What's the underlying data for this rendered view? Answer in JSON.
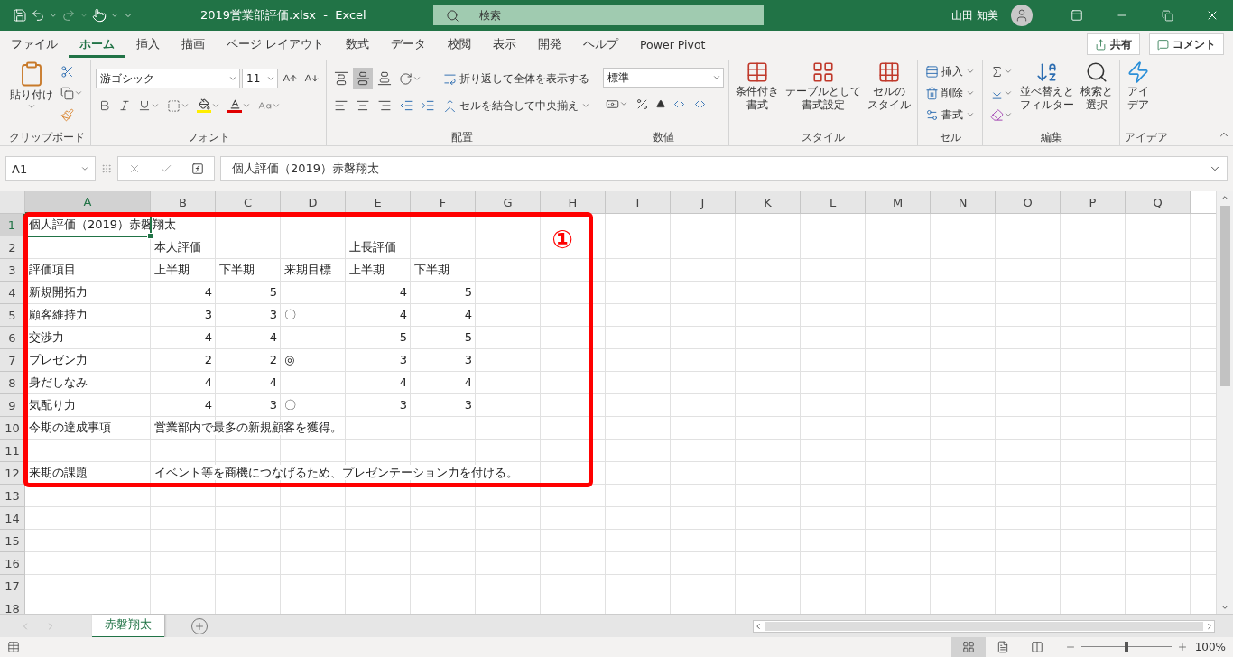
{
  "title_bar": {
    "title": "2019営業部評価.xlsx  -  Excel",
    "search": {
      "placeholder": "検索"
    },
    "user": "山田 知美"
  },
  "menu_tabs": [
    {
      "label": "ファイル",
      "selected": false
    },
    {
      "label": "ホーム",
      "selected": true
    },
    {
      "label": "挿入",
      "selected": false
    },
    {
      "label": "描画",
      "selected": false
    },
    {
      "label": "ページ レイアウト",
      "selected": false
    },
    {
      "label": "数式",
      "selected": false
    },
    {
      "label": "データ",
      "selected": false
    },
    {
      "label": "校閲",
      "selected": false
    },
    {
      "label": "表示",
      "selected": false
    },
    {
      "label": "開発",
      "selected": false
    },
    {
      "label": "ヘルプ",
      "selected": false
    },
    {
      "label": "Power Pivot",
      "selected": false
    }
  ],
  "share": "共有",
  "comment": "コメント",
  "ribbon": {
    "clipboard": {
      "label": "クリップボード",
      "paste": "貼り付け"
    },
    "font": {
      "label": "フォント",
      "font_name": "游ゴシック",
      "font_size": "11"
    },
    "alignment": {
      "label": "配置",
      "vertical": [
        {
          "kind": "top",
          "selected": false
        },
        {
          "kind": "middle",
          "selected": true
        },
        {
          "kind": "bottom",
          "selected": false
        }
      ],
      "wrap": "折り返して全体を表示する",
      "merge": "セルを結合して中央揃え"
    },
    "number": {
      "label": "数値",
      "format": "標準"
    },
    "styles": {
      "label": "スタイル",
      "items": [
        {
          "lines": [
            "条件付き",
            "書式"
          ]
        },
        {
          "lines": [
            "テーブルとして",
            "書式設定"
          ]
        },
        {
          "lines": [
            "セルの",
            "スタイル"
          ]
        }
      ]
    },
    "cells": {
      "label": "セル",
      "items": [
        "挿入",
        "削除",
        "書式"
      ]
    },
    "editing": {
      "label": "編集",
      "items": [
        {
          "lines": [
            "並べ替えと",
            "フィルター"
          ]
        },
        {
          "lines": [
            "検索と",
            "選択"
          ]
        }
      ]
    },
    "ideas": {
      "label": "アイデア",
      "lines": [
        "アイ",
        "デア"
      ]
    }
  },
  "formula_bar": {
    "name_box": "A1",
    "formula": "個人評価（2019）赤磐翔太"
  },
  "sheet": {
    "columns": [
      {
        "label": "A",
        "selected": true
      },
      {
        "label": "B",
        "selected": false
      },
      {
        "label": "C",
        "selected": false
      },
      {
        "label": "D",
        "selected": false
      },
      {
        "label": "E",
        "selected": false
      },
      {
        "label": "F",
        "selected": false
      },
      {
        "label": "G",
        "selected": false
      },
      {
        "label": "H",
        "selected": false
      },
      {
        "label": "I",
        "selected": false
      },
      {
        "label": "J",
        "selected": false
      },
      {
        "label": "K",
        "selected": false
      },
      {
        "label": "L",
        "selected": false
      },
      {
        "label": "M",
        "selected": false
      },
      {
        "label": "N",
        "selected": false
      },
      {
        "label": "O",
        "selected": false
      },
      {
        "label": "P",
        "selected": false
      },
      {
        "label": "Q",
        "selected": false
      }
    ],
    "rows": [
      {
        "header": "1",
        "selected": true,
        "cells": [
          {
            "text": "個人評価（2019）赤磐翔太",
            "kind": "text"
          }
        ]
      },
      {
        "header": "2",
        "selected": false,
        "cells": [
          null,
          {
            "text": "本人評価",
            "kind": "text"
          },
          null,
          null,
          {
            "text": "上長評価",
            "kind": "text"
          }
        ]
      },
      {
        "header": "3",
        "selected": false,
        "cells": [
          {
            "text": "評価項目",
            "kind": "text"
          },
          {
            "text": "上半期",
            "kind": "text"
          },
          {
            "text": "下半期",
            "kind": "text"
          },
          {
            "text": "来期目標",
            "kind": "text"
          },
          {
            "text": "上半期",
            "kind": "text"
          },
          {
            "text": "下半期",
            "kind": "text"
          }
        ]
      },
      {
        "header": "4",
        "selected": false,
        "cells": [
          {
            "text": "新規開拓力",
            "kind": "text"
          },
          {
            "text": "4",
            "kind": "number"
          },
          {
            "text": "5",
            "kind": "number"
          },
          null,
          {
            "text": "4",
            "kind": "number"
          },
          {
            "text": "5",
            "kind": "number"
          }
        ]
      },
      {
        "header": "5",
        "selected": false,
        "cells": [
          {
            "text": "顧客維持力",
            "kind": "text"
          },
          {
            "text": "3",
            "kind": "number"
          },
          {
            "text": "3",
            "kind": "number"
          },
          {
            "text": "〇",
            "kind": "text"
          },
          {
            "text": "4",
            "kind": "number"
          },
          {
            "text": "4",
            "kind": "number"
          }
        ]
      },
      {
        "header": "6",
        "selected": false,
        "cells": [
          {
            "text": "交渉力",
            "kind": "text"
          },
          {
            "text": "4",
            "kind": "number"
          },
          {
            "text": "4",
            "kind": "number"
          },
          null,
          {
            "text": "5",
            "kind": "number"
          },
          {
            "text": "5",
            "kind": "number"
          }
        ]
      },
      {
        "header": "7",
        "selected": false,
        "cells": [
          {
            "text": "プレゼン力",
            "kind": "text"
          },
          {
            "text": "2",
            "kind": "number"
          },
          {
            "text": "2",
            "kind": "number"
          },
          {
            "text": "◎",
            "kind": "text"
          },
          {
            "text": "3",
            "kind": "number"
          },
          {
            "text": "3",
            "kind": "number"
          }
        ]
      },
      {
        "header": "8",
        "selected": false,
        "cells": [
          {
            "text": "身だしなみ",
            "kind": "text"
          },
          {
            "text": "4",
            "kind": "number"
          },
          {
            "text": "4",
            "kind": "number"
          },
          null,
          {
            "text": "4",
            "kind": "number"
          },
          {
            "text": "4",
            "kind": "number"
          }
        ]
      },
      {
        "header": "9",
        "selected": false,
        "cells": [
          {
            "text": "気配り力",
            "kind": "text"
          },
          {
            "text": "4",
            "kind": "number"
          },
          {
            "text": "3",
            "kind": "number"
          },
          {
            "text": "〇",
            "kind": "text"
          },
          {
            "text": "3",
            "kind": "number"
          },
          {
            "text": "3",
            "kind": "number"
          }
        ]
      },
      {
        "header": "10",
        "selected": false,
        "cells": [
          {
            "text": "今期の達成事項",
            "kind": "text"
          },
          {
            "text": "営業部内で最多の新規顧客を獲得。",
            "kind": "text"
          }
        ]
      },
      {
        "header": "11",
        "selected": false
      },
      {
        "header": "12",
        "selected": false,
        "cells": [
          {
            "text": "来期の課題",
            "kind": "text"
          },
          {
            "text": "イベント等を商機につなげるため、プレゼンテーション力を付ける。",
            "kind": "text"
          }
        ]
      },
      {
        "header": "13",
        "selected": false
      },
      {
        "header": "14",
        "selected": false
      },
      {
        "header": "15",
        "selected": false
      },
      {
        "header": "16",
        "selected": false
      },
      {
        "header": "17",
        "selected": false
      },
      {
        "header": "18",
        "selected": false
      }
    ]
  },
  "annotation": {
    "label": "①"
  },
  "sheet_tabs": [
    {
      "label": "赤磐翔太",
      "selected": true
    }
  ],
  "status_bar": {
    "views": [
      {
        "kind": "normal",
        "selected": true
      },
      {
        "kind": "page_layout",
        "selected": false
      },
      {
        "kind": "page_break",
        "selected": false
      }
    ],
    "zoom": {
      "level": 0.5,
      "reading": "100%"
    }
  }
}
